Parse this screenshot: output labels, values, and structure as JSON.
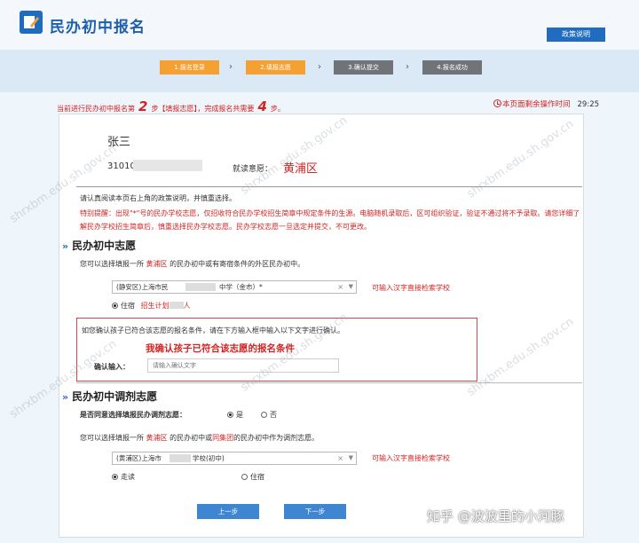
{
  "header": {
    "title": "民办初中报名",
    "policy_button": "政策说明"
  },
  "steps": [
    {
      "label": "1.报名登录",
      "state": "done"
    },
    {
      "label": "2.填报志愿",
      "state": "current"
    },
    {
      "label": "3.确认提交",
      "state": "pending"
    },
    {
      "label": "4.报名成功",
      "state": "pending"
    }
  ],
  "notice": {
    "prefix": "当前进行民办初中报名第",
    "step_num": "2",
    "middle": "步【填报志愿】，完成报名共需要",
    "total": "4",
    "suffix": "步。"
  },
  "timer": {
    "label": "本页面剩余操作时间",
    "value": "29:25"
  },
  "student": {
    "name": "张三",
    "id_prefix": "31010",
    "district_label": "就读意愿：",
    "district": "黄浦区"
  },
  "instructions": {
    "read_tip": "请认真阅读本页右上角的政策说明，并慎重选择。",
    "special_note": "特别提醒：出现\"*\"号的民办学校志愿，仅招收符合民办学校招生简章中规定条件的生源。电脑随机录取后，区可组织验证，验证不通过将不予录取。请您详细了解民办学校招生简章后，慎重选择民办学校志愿。民办学校志愿一旦选定并提交，不可更改。"
  },
  "section1": {
    "title": "民办初中志愿",
    "desc_pre": "您可以选择填报一所",
    "desc_district": "黄浦区",
    "desc_post": "的民办初中或有寄宿条件的外区民办初中。",
    "select_left": "(静安区)上海市民",
    "select_right": "中学（金市）*",
    "search_hint": "可输入汉字直接检索学校",
    "boarding_label": "住宿",
    "plan_label": "招生计划",
    "plan_suffix": "人"
  },
  "confirm": {
    "instruction": "如您确认孩子已符合该志愿的报名条件，请在下方输入框中输入以下文字进行确认。",
    "phrase": "我确认孩子已符合该志愿的报名条件",
    "input_label": "确认输入：",
    "input_placeholder": "请输入确认文字"
  },
  "section2": {
    "title": "民办初中调剂志愿",
    "question": "是否同意选择填报民办调剂志愿：",
    "yes": "是",
    "no": "否",
    "desc_pre": "您可以选择填报一所",
    "desc_district": "黄浦区",
    "desc_mid": "的民办初中或",
    "desc_group": "同集团",
    "desc_post": "的民办初中作为调剂志愿。",
    "select_left": "(黄浦区)上海市",
    "select_right": "学校(初中)",
    "search_hint": "可输入汉字直接检索学校",
    "opt_day": "走读",
    "opt_board": "住宿"
  },
  "buttons": {
    "prev": "上一步",
    "next": "下一步"
  },
  "watermark": "shrxbm.edu.sh.gov.cn",
  "credit": "知乎 @波波里的小河豚",
  "colors": {
    "brand": "#1e6bc0",
    "active_step": "#f5a033",
    "pending_step": "#6f7479",
    "alert": "#d32323"
  }
}
